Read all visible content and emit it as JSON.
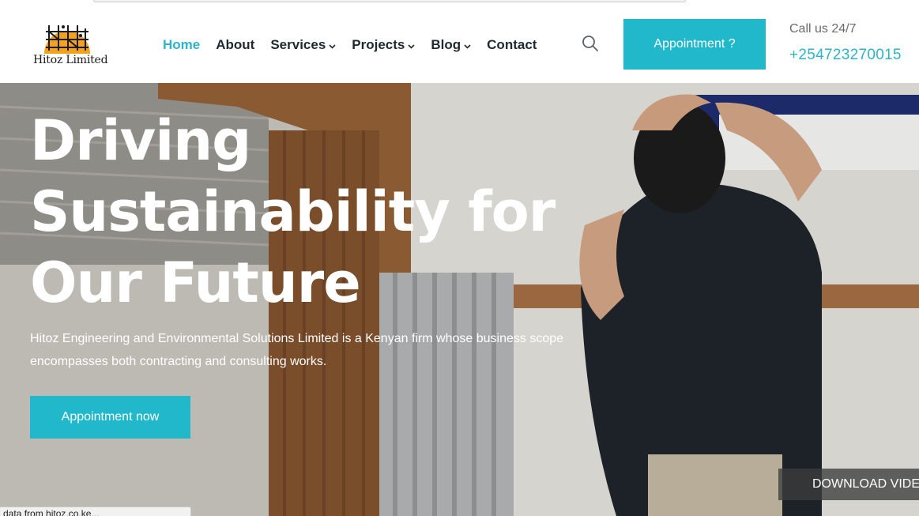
{
  "brand": {
    "name": "Hitoz Limited"
  },
  "nav": {
    "items": [
      {
        "label": "Home",
        "active": true,
        "dropdown": false
      },
      {
        "label": "About",
        "active": false,
        "dropdown": false
      },
      {
        "label": "Services",
        "active": false,
        "dropdown": true
      },
      {
        "label": "Projects",
        "active": false,
        "dropdown": true
      },
      {
        "label": "Blog",
        "active": false,
        "dropdown": true
      },
      {
        "label": "Contact",
        "active": false,
        "dropdown": false
      }
    ]
  },
  "header": {
    "appointment_label": "Appointment ?",
    "call_label": "Call us 24/7",
    "phone": "+254723270015"
  },
  "hero": {
    "title_lines": [
      "Driving",
      "Sustainability for",
      "Our Future"
    ],
    "description": "Hitoz Engineering and Environmental Solutions Limited is a Kenyan firm whose business scope encompasses both contracting and consulting works.",
    "button_label": "Appointment now",
    "download_label": "DOWNLOAD VIDEO"
  },
  "status_bar": {
    "text": "a data from hitoz.co.ke..."
  },
  "colors": {
    "accent": "#22b8cc",
    "nav_text": "#1e2a32",
    "active_nav": "#2bb5c8"
  },
  "icons": {
    "search": "search-icon",
    "chevron": "chevron-down-icon",
    "logo": "scaffold-logo-icon"
  }
}
